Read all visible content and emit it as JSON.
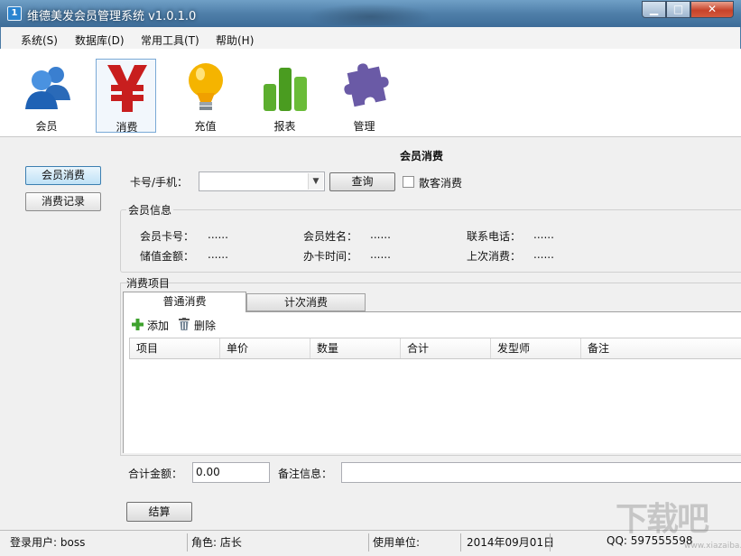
{
  "window": {
    "title": "维德美发会员管理系统 v1.0.1.0",
    "min_glyph": "▁",
    "max_glyph": "□",
    "close_glyph": "✕"
  },
  "menu": [
    "系统(S)",
    "数据库(D)",
    "常用工具(T)",
    "帮助(H)"
  ],
  "toolbar": [
    {
      "label": "会员",
      "icon": "members-icon"
    },
    {
      "label": "消费",
      "icon": "yen-icon",
      "selected": true
    },
    {
      "label": "充值",
      "icon": "lightbulb-icon"
    },
    {
      "label": "报表",
      "icon": "bar-chart-icon"
    },
    {
      "label": "管理",
      "icon": "puzzle-icon"
    }
  ],
  "side": {
    "consume": "会员消费",
    "records": "消费记录"
  },
  "form": {
    "title": "会员消费",
    "card_label": "卡号/手机：",
    "card_value": "",
    "query": "查询",
    "walkin": "散客消费"
  },
  "member_info": {
    "legend": "会员信息",
    "card_no_label": "会员卡号：",
    "card_no": "......",
    "name_label": "会员姓名：",
    "name": "......",
    "phone_label": "联系电话：",
    "phone": "......",
    "balance_label": "储值金额：",
    "balance": "......",
    "open_label": "办卡时间：",
    "open": "......",
    "last_label": "上次消费：",
    "last": "......"
  },
  "items": {
    "legend": "消费项目",
    "tabs": [
      "普通消费",
      "计次消费"
    ],
    "add": "添加",
    "delete": "删除",
    "columns": [
      "项目",
      "单价",
      "数量",
      "合计",
      "发型师",
      "备注"
    ]
  },
  "totals": {
    "total_label": "合计金额：",
    "total_value": "0.00",
    "remark_label": "备注信息：",
    "remark_value": "",
    "settle": "结算"
  },
  "status": {
    "user": "登录用户: boss",
    "role": "角色: 店长",
    "unit": "使用单位:",
    "date": "2014年09月01日",
    "qq": "QQ: 597555598"
  },
  "watermark": {
    "text": "下载吧",
    "sub": "www.xiazaiba.com"
  },
  "colors": {
    "title_bar": "#4f7fa9",
    "accent": "#3c7fb1",
    "close": "#c7432a"
  }
}
